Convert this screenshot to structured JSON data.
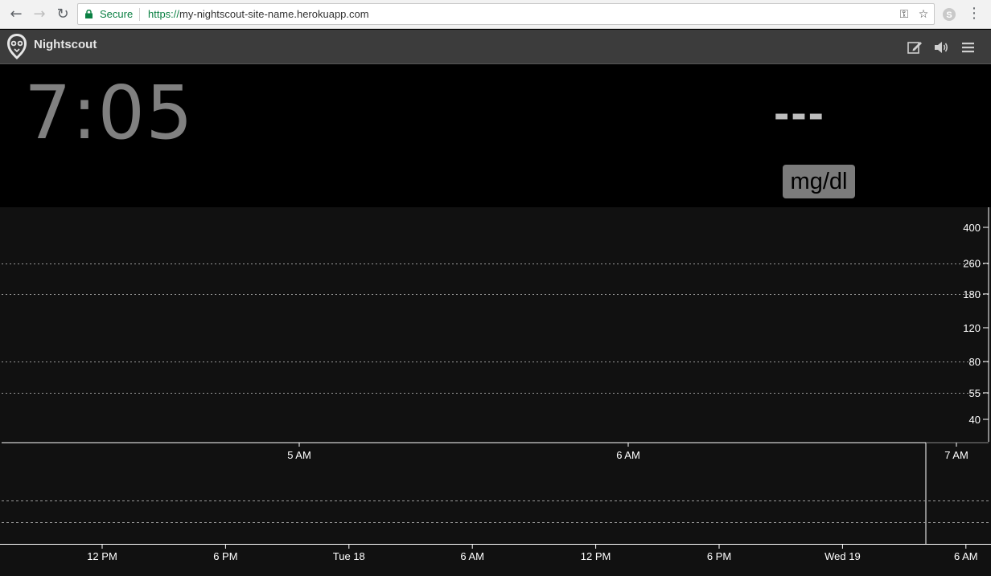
{
  "browser": {
    "secure_label": "Secure",
    "url_scheme": "https://",
    "url_host": "my-nightscout-site-name.herokuapp.com"
  },
  "app": {
    "name": "Nightscout",
    "clock": "7:05",
    "bg_value": "---",
    "units": "mg/dl"
  },
  "colors": {
    "header_bg": "#3c3c3c",
    "chart_bg": "#111111",
    "clock": "#808080",
    "units_bg": "#7b7b7b"
  },
  "chart_data": {
    "main": {
      "type": "line",
      "y_scale": "log",
      "y_ticks": [
        400,
        260,
        180,
        120,
        80,
        55,
        40
      ],
      "x_ticks": [
        "5 AM",
        "6 AM",
        "7 AM"
      ],
      "threshold_lines": [
        260,
        180,
        80,
        55
      ],
      "series": []
    },
    "overview": {
      "type": "line",
      "x_ticks": [
        "12 PM",
        "6 PM",
        "Tue 18",
        "6 AM",
        "12 PM",
        "6 PM",
        "Wed 19",
        "6 AM"
      ],
      "series": []
    }
  }
}
